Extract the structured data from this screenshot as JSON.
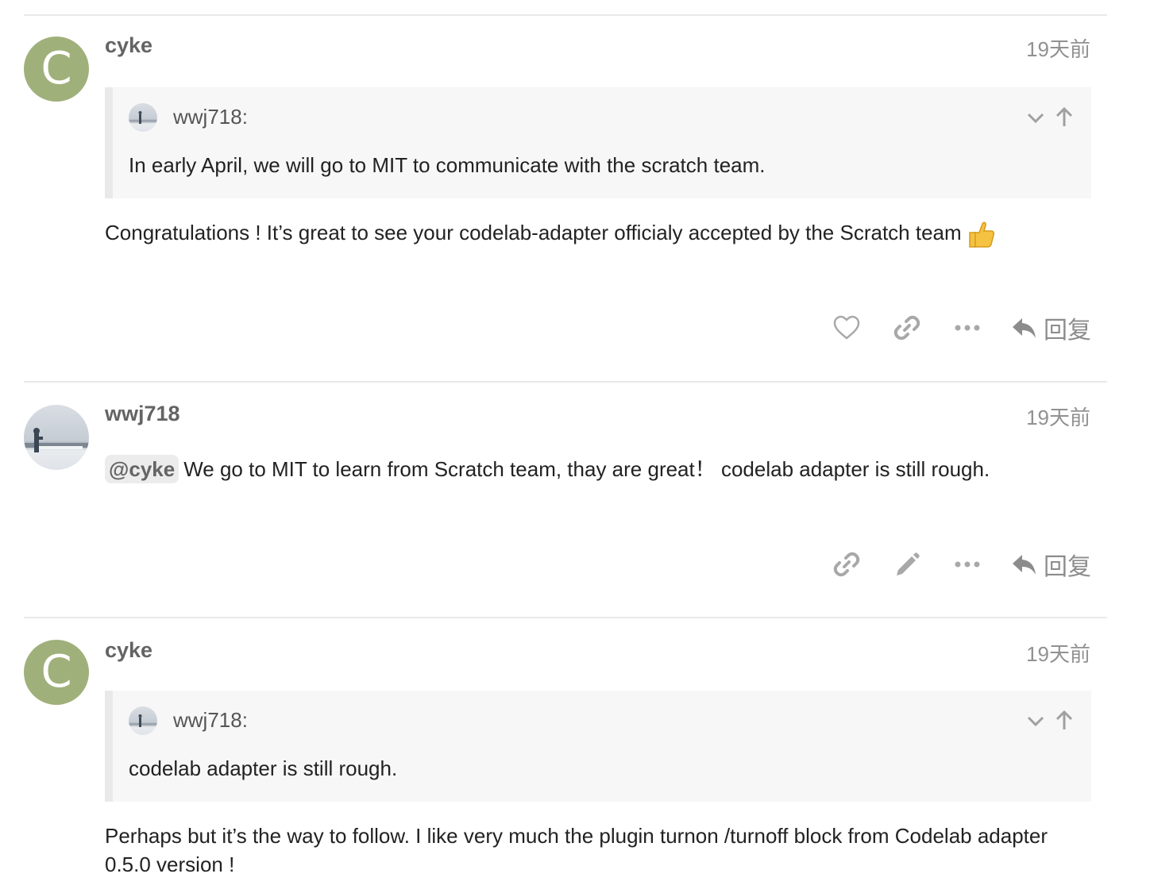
{
  "posts": [
    {
      "username": "cyke",
      "avatar_letter": "C",
      "timestamp": "19天前",
      "quote": {
        "author": "wwj718:",
        "text": "In early April, we will go to MIT to communicate with the scratch team."
      },
      "body": "Congratulations ! It’s great to see your codelab-adapter officialy accepted by the Scratch team",
      "emoji": "thumbs-up",
      "actions": [
        "like-icon",
        "link-icon",
        "more-icon"
      ],
      "reply_label": "回复"
    },
    {
      "username": "wwj718",
      "timestamp": "19天前",
      "mention": "@cyke",
      "body": "We go to MIT to learn from Scratch team, thay are great！ codelab adapter is still rough.",
      "actions": [
        "link-icon",
        "edit-icon",
        "more-icon"
      ],
      "reply_label": "回复"
    },
    {
      "username": "cyke",
      "avatar_letter": "C",
      "timestamp": "19天前",
      "quote": {
        "author": "wwj718:",
        "text": "codelab adapter is still rough."
      },
      "body_line1": "Perhaps but it’s the way to follow. I like very much the plugin turnon /turnoff block from Codelab adapter",
      "body_line2": "0.5.0 version !"
    }
  ],
  "colors": {
    "avatar_green": "#a0b07a",
    "text": "#222222",
    "muted": "#919191",
    "quote_bg": "#f7f7f7"
  }
}
